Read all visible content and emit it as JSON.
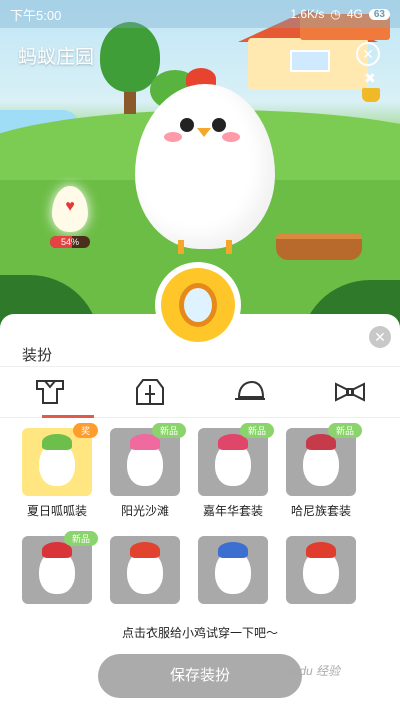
{
  "status_bar": {
    "time": "下午5:00",
    "network_speed": "1.6K/s",
    "signal": "4G",
    "battery": "63"
  },
  "scene": {
    "title": "蚂蚁庄园",
    "egg_progress_text": "54%",
    "egg_progress_value": 0.54,
    "close_icon": "close-icon",
    "mirror_icon": "mirror-icon"
  },
  "panel": {
    "title": "装扮",
    "tabs": [
      {
        "icon": "clothes-icon",
        "active": true
      },
      {
        "icon": "jacket-icon",
        "active": false
      },
      {
        "icon": "hat-icon",
        "active": false
      },
      {
        "icon": "bowtie-icon",
        "active": false
      }
    ],
    "items_row1": [
      {
        "name": "夏日呱呱装",
        "badge": "奖",
        "selected": true
      },
      {
        "name": "阳光沙滩",
        "badge": "新品",
        "selected": false
      },
      {
        "name": "嘉年华套装",
        "badge": "新品",
        "selected": false
      },
      {
        "name": "哈尼族套装",
        "badge": "新品",
        "selected": false
      }
    ],
    "items_row2": [
      {
        "name": "",
        "badge": "新品"
      },
      {
        "name": "",
        "badge": ""
      },
      {
        "name": "",
        "badge": ""
      },
      {
        "name": "",
        "badge": ""
      }
    ],
    "hint": "点击衣服给小鸡试穿一下吧～",
    "save_label": "保存装扮"
  },
  "watermark": "Baidu 经验",
  "colors": {
    "accent_red": "#e05a4a",
    "badge_green": "#8bd36c",
    "badge_orange": "#ff9c2e",
    "selected_bg": "#ffe680",
    "button_gray": "#ababab"
  }
}
